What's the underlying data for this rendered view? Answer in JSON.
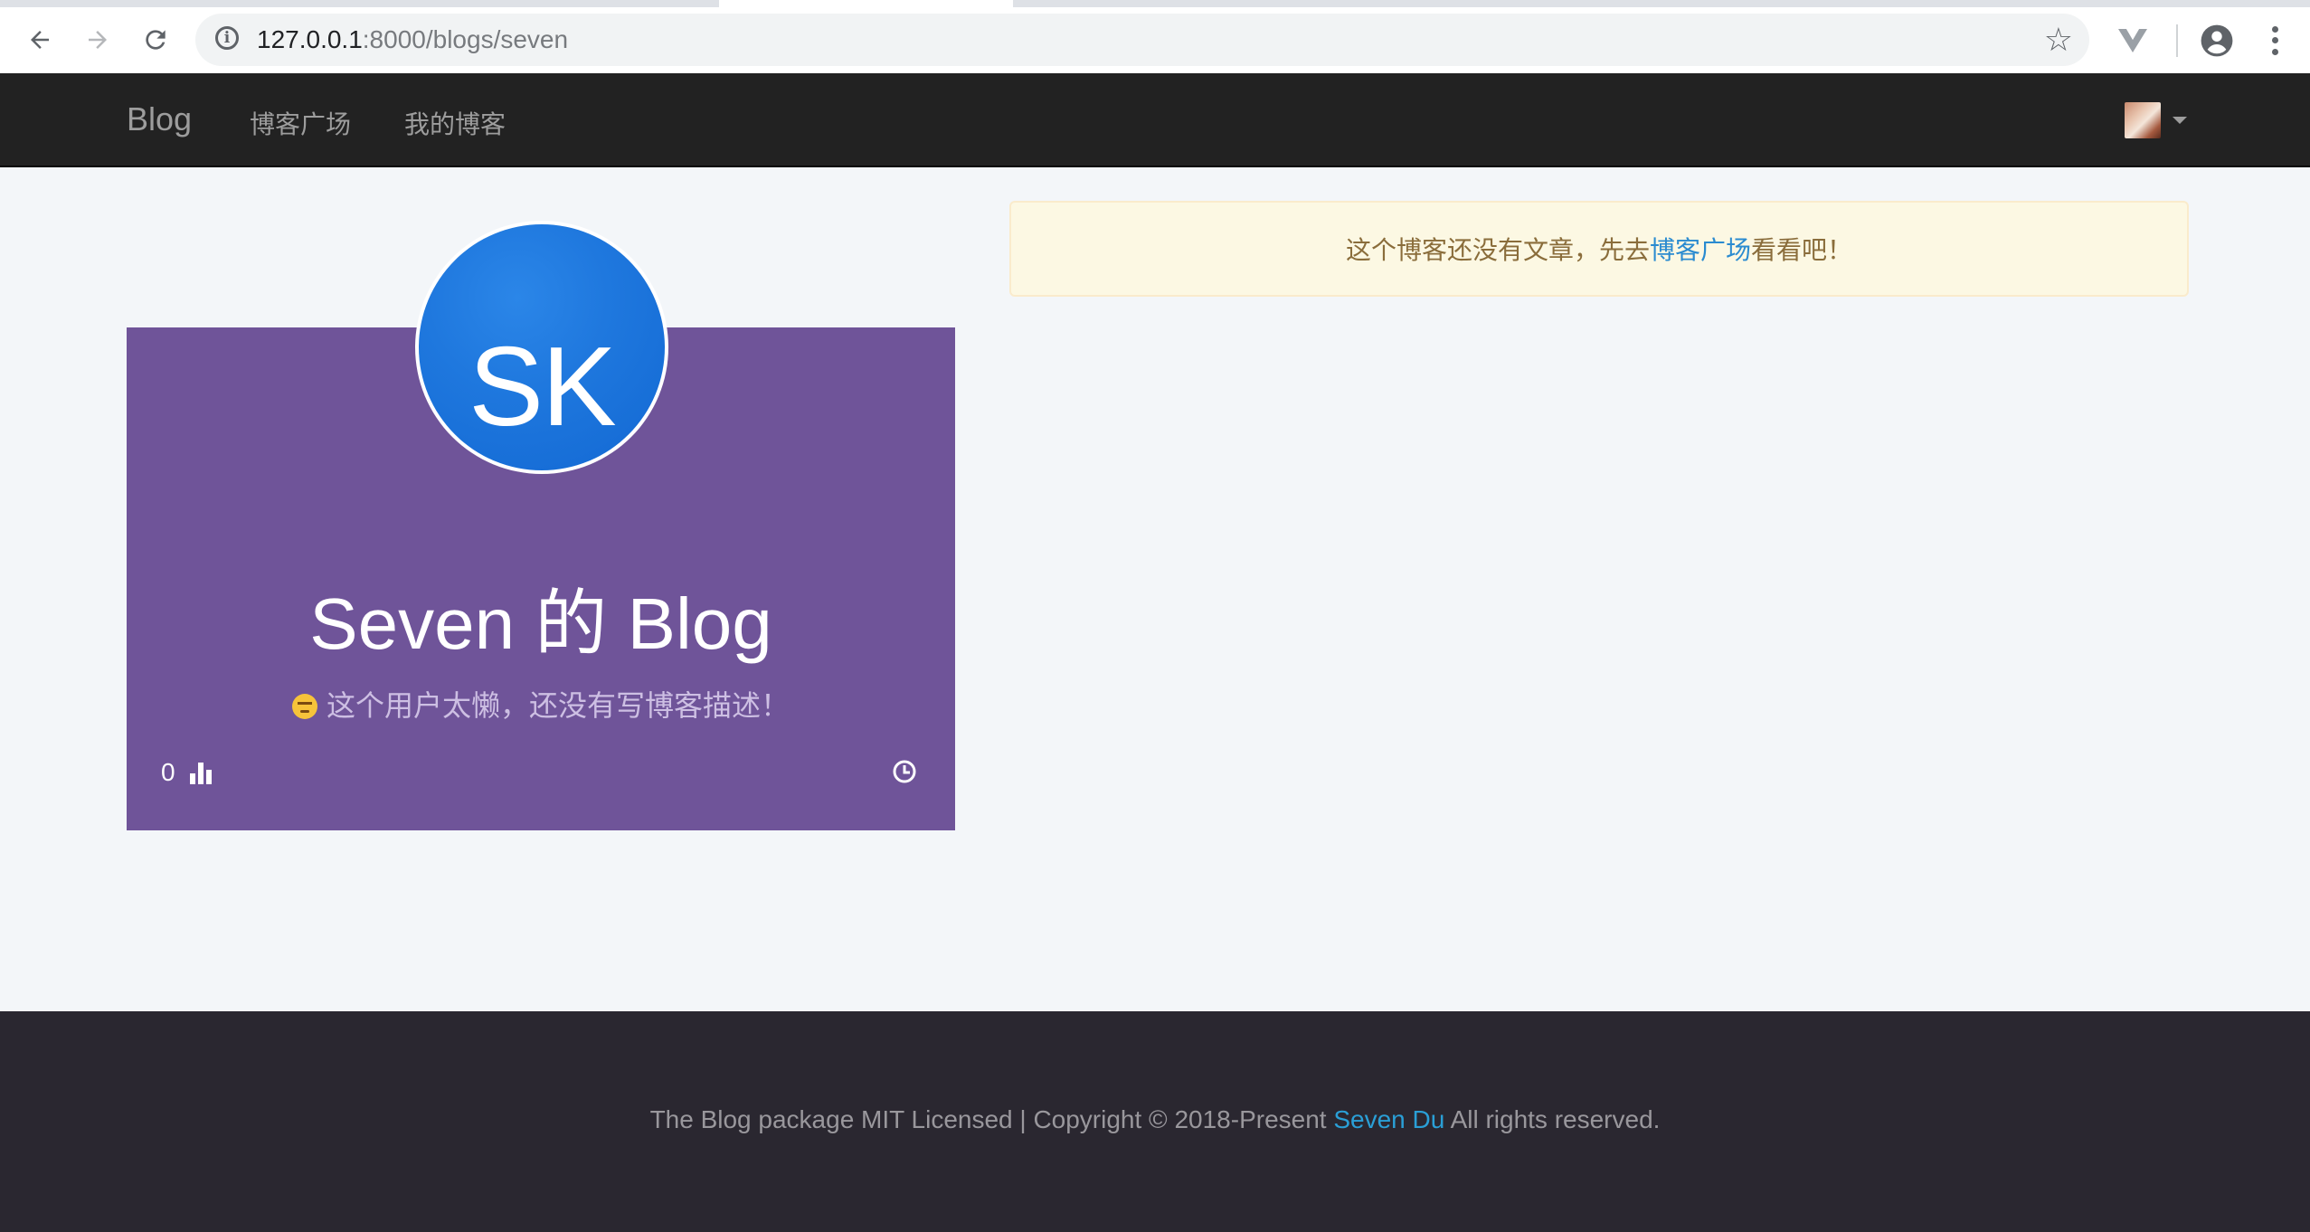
{
  "browser": {
    "url_host": "127.0.0.1",
    "url_rest": ":8000/blogs/seven",
    "icons": [
      "back-icon",
      "forward-icon",
      "reload-icon",
      "info-icon",
      "star-icon",
      "vue-devtools-icon",
      "account-icon",
      "more-vert-icon"
    ]
  },
  "navbar": {
    "brand": "Blog",
    "links": [
      "博客广场",
      "我的博客"
    ]
  },
  "profile": {
    "initials": "SK",
    "title": "Seven 的 Blog",
    "description": "这个用户太懒，还没有写博客描述！",
    "stat_count": "0",
    "colors": {
      "card": "#6f5499",
      "avatar": "#1f78de"
    }
  },
  "alert": {
    "prefix": "这个博客还没有文章，先去",
    "link": "博客广场",
    "suffix": "看看吧！"
  },
  "footer": {
    "text_before": "The Blog package MIT Licensed | Copyright © 2018-Present ",
    "author": "Seven Du",
    "text_after": " All rights reserved."
  }
}
